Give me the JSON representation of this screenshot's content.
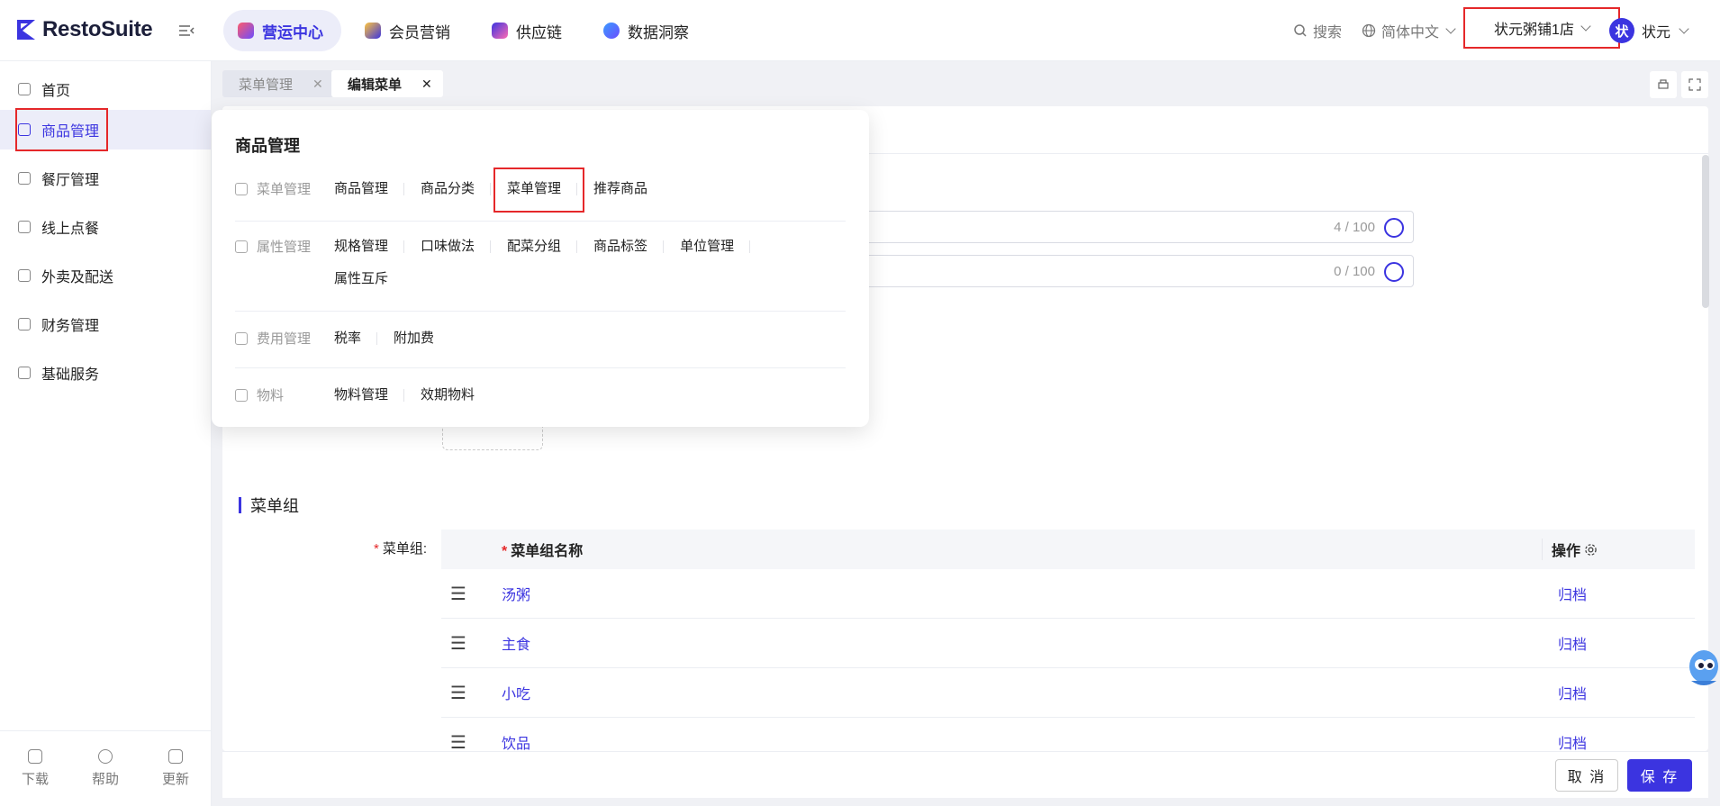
{
  "app": {
    "logo_text": "RestoSuite",
    "colors": {
      "brand": "#3b34e0",
      "highlight_box": "#e5282a"
    }
  },
  "topnav": {
    "items": [
      {
        "label": "营运中心",
        "icon": "ops-icon",
        "active": true
      },
      {
        "label": "会员营销",
        "icon": "member-icon"
      },
      {
        "label": "供应链",
        "icon": "supply-icon"
      },
      {
        "label": "数据洞察",
        "icon": "data-icon"
      }
    ],
    "search_label": "搜索",
    "lang_label": "简体中文",
    "store_label": "状元粥铺1店",
    "user_avatar": "状",
    "user_name": "状元"
  },
  "sidebar": {
    "items": [
      {
        "label": "首页",
        "icon": "home-icon"
      },
      {
        "label": "商品管理",
        "icon": "cube-icon",
        "active": true
      },
      {
        "label": "餐厅管理",
        "icon": "store-icon"
      },
      {
        "label": "线上点餐",
        "icon": "tap-icon"
      },
      {
        "label": "外卖及配送",
        "icon": "bag-icon"
      },
      {
        "label": "财务管理",
        "icon": "folder-icon"
      },
      {
        "label": "基础服务",
        "icon": "grid-icon"
      }
    ],
    "footer": [
      {
        "label": "下载",
        "icon": "download-icon"
      },
      {
        "label": "帮助",
        "icon": "help-icon"
      },
      {
        "label": "更新",
        "icon": "update-icon"
      }
    ]
  },
  "tabs": [
    {
      "label": "菜单管理"
    },
    {
      "label": "编辑菜单",
      "active": true
    }
  ],
  "form": {
    "field1_count": "4 / 100",
    "field2_count": "0 / 100"
  },
  "menu_group_section": {
    "title": "菜单组",
    "field_label": "菜单组:",
    "col_name": "菜单组名称",
    "col_op": "操作",
    "rows": [
      {
        "name": "汤粥",
        "action": "归档"
      },
      {
        "name": "主食",
        "action": "归档"
      },
      {
        "name": "小吃",
        "action": "归档"
      },
      {
        "name": "饮品",
        "action": "归档"
      }
    ]
  },
  "footer": {
    "cancel_label": "取 消",
    "save_label": "保 存"
  },
  "dropdown": {
    "title": "商品管理",
    "groups": [
      {
        "label": "菜单管理",
        "icon": "menu-doc-icon",
        "links": [
          "商品管理",
          "商品分类",
          "菜单管理",
          "推荐商品"
        ]
      },
      {
        "label": "属性管理",
        "icon": "attr-icon",
        "links": [
          "规格管理",
          "口味做法",
          "配菜分组",
          "商品标签",
          "单位管理",
          "属性互斥"
        ]
      },
      {
        "label": "费用管理",
        "icon": "fee-icon",
        "links": [
          "税率",
          "附加费"
        ]
      },
      {
        "label": "物料",
        "icon": "material-icon",
        "links": [
          "物料管理",
          "效期物料"
        ]
      }
    ]
  }
}
